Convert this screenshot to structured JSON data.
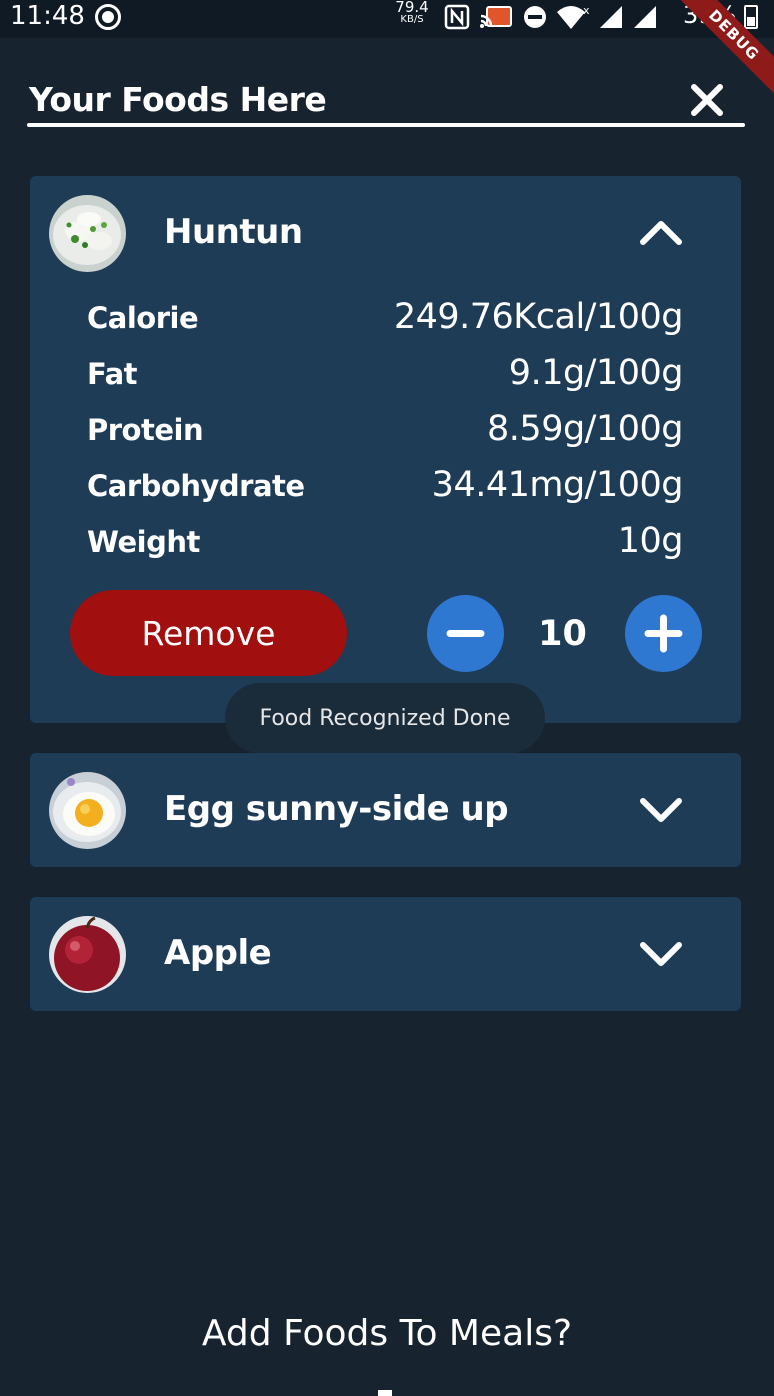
{
  "status_bar": {
    "time": "11:48",
    "speed_value": "79.4",
    "speed_unit": "KB/S",
    "battery_percent": "39%"
  },
  "debug_banner": "DEBUG",
  "header": {
    "title": "Your Foods Here",
    "close_icon": "close-icon"
  },
  "foods": [
    {
      "name": "Huntun",
      "expanded": true,
      "nutrients": [
        {
          "label": "Calorie",
          "value": "249.76Kcal/100g"
        },
        {
          "label": "Fat",
          "value": "9.1g/100g"
        },
        {
          "label": "Protein",
          "value": "8.59g/100g"
        },
        {
          "label": "Carbohydrate",
          "value": "34.41mg/100g"
        },
        {
          "label": "Weight",
          "value": "10g"
        }
      ],
      "remove_label": "Remove",
      "quantity": "10"
    },
    {
      "name": "Egg sunny-side up",
      "expanded": false
    },
    {
      "name": "Apple",
      "expanded": false
    }
  ],
  "toast": "Food Recognized Done",
  "footer": {
    "add_to_meals": "Add Foods To Meals?"
  },
  "colors": {
    "background": "#17232f",
    "card": "#1e3c56",
    "remove": "#a10f0f",
    "stepper": "#2e78d2",
    "debug": "#8e1a1a"
  }
}
